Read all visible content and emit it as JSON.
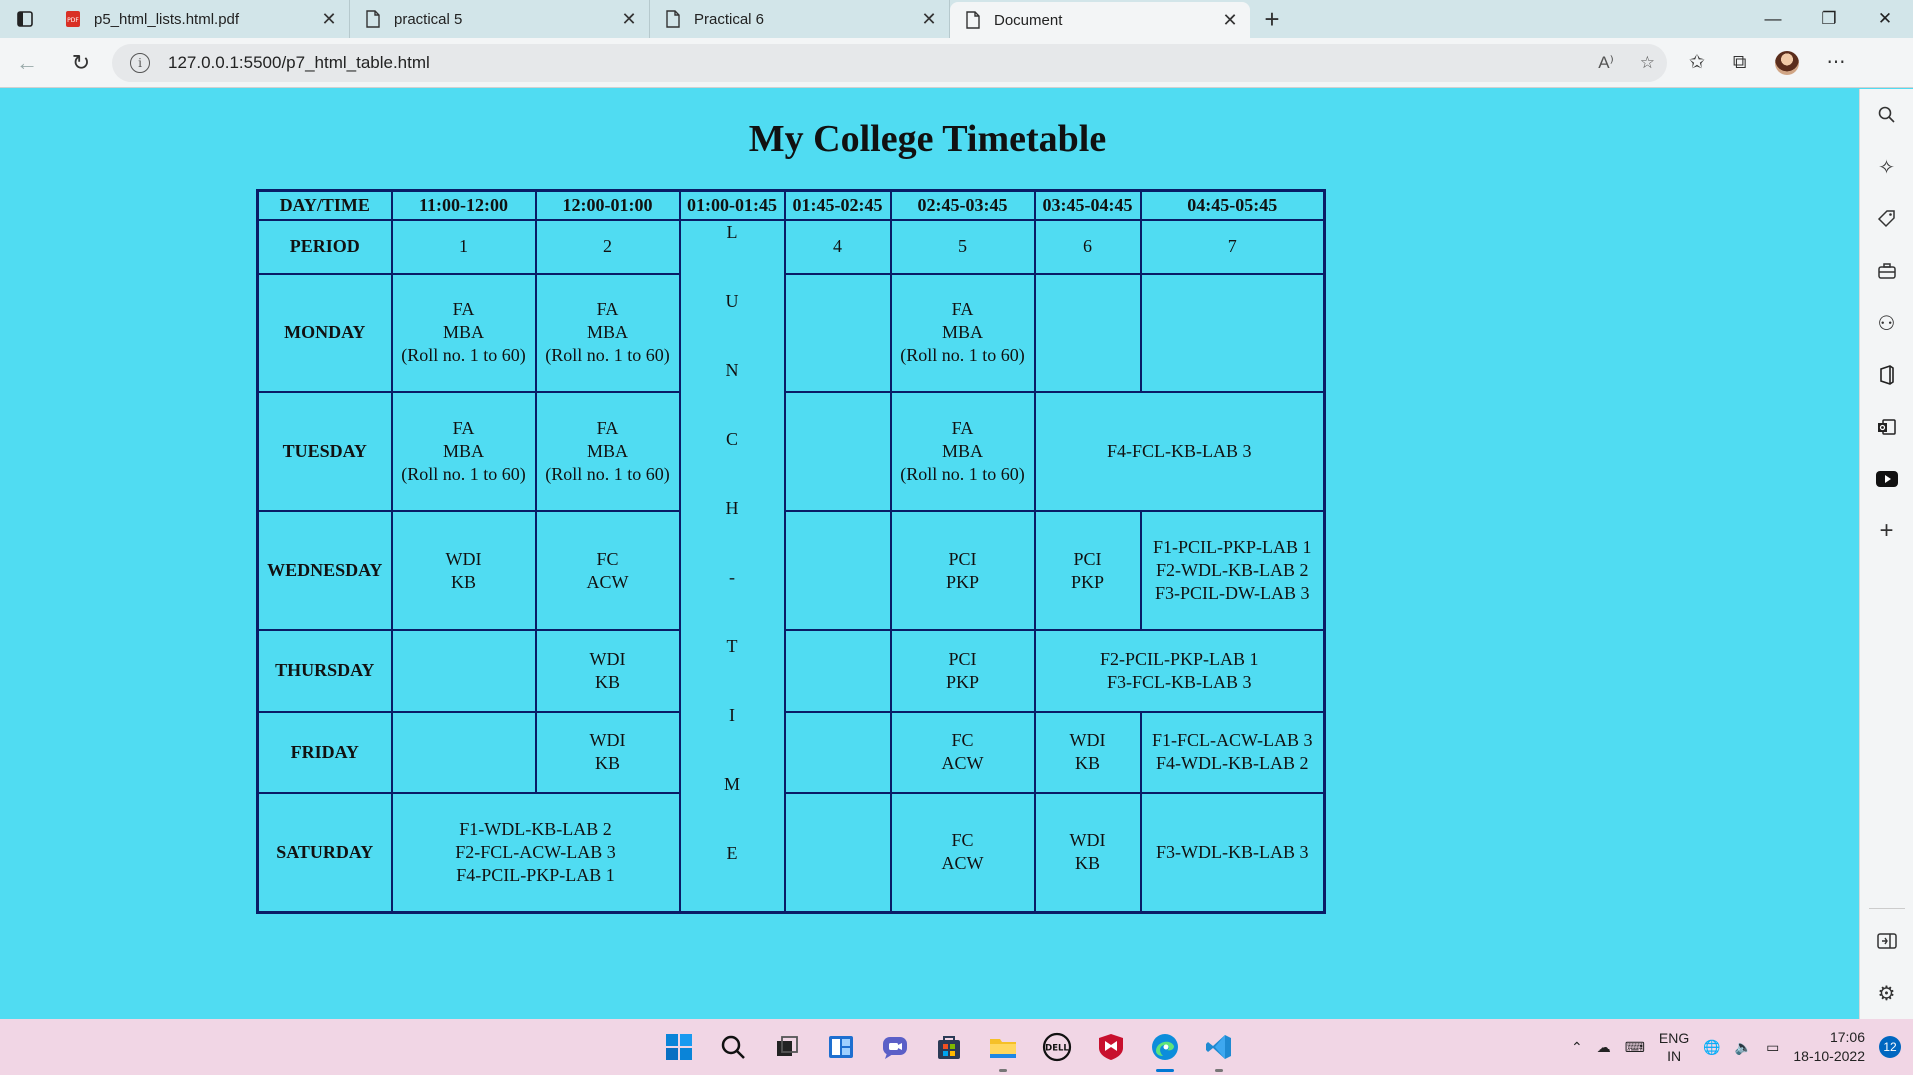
{
  "browser": {
    "tabs": [
      {
        "label": "p5_html_lists.html.pdf",
        "icon": "pdf-icon",
        "active": false
      },
      {
        "label": "practical 5",
        "icon": "page-icon",
        "active": false
      },
      {
        "label": "Practical 6",
        "icon": "page-icon",
        "active": false
      },
      {
        "label": "Document",
        "icon": "page-icon",
        "active": true
      }
    ],
    "url": "127.0.0.1:5500/p7_html_table.html"
  },
  "page": {
    "title": "My College Timetable",
    "headers": [
      "DAY/TIME",
      "11:00-12:00",
      "12:00-01:00",
      "01:00-01:45",
      "01:45-02:45",
      "02:45-03:45",
      "03:45-04:45",
      "04:45-05:45"
    ],
    "period_label": "PERIOD",
    "periods": [
      "1",
      "2",
      "4",
      "5",
      "6",
      "7"
    ],
    "lunch_letters": [
      "L",
      "U",
      "N",
      "C",
      "H",
      "-",
      "T",
      "I",
      "M",
      "E"
    ],
    "days": {
      "monday": {
        "name": "MONDAY",
        "p1": [
          "FA",
          "MBA",
          "(Roll no. 1 to 60)"
        ],
        "p2": [
          "FA",
          "MBA",
          "(Roll no. 1 to 60)"
        ],
        "p5": [
          "FA",
          "MBA",
          "(Roll no. 1 to 60)"
        ]
      },
      "tuesday": {
        "name": "TUESDAY",
        "p1": [
          "FA",
          "MBA",
          "(Roll no. 1 to 60)"
        ],
        "p2": [
          "FA",
          "MBA",
          "(Roll no. 1 to 60)"
        ],
        "p5": [
          "FA",
          "MBA",
          "(Roll no. 1 to 60)"
        ],
        "p67": "F4-FCL-KB-LAB 3"
      },
      "wednesday": {
        "name": "WEDNESDAY",
        "p1": [
          "WDI",
          "KB"
        ],
        "p2": [
          "FC",
          "ACW"
        ],
        "p5": [
          "PCI",
          "PKP"
        ],
        "p6": [
          "PCI",
          "PKP"
        ],
        "p7": [
          "F1-PCIL-PKP-LAB 1",
          "F2-WDL-KB-LAB 2",
          "F3-PCIL-DW-LAB 3"
        ]
      },
      "thursday": {
        "name": "THURSDAY",
        "p2": [
          "WDI",
          "KB"
        ],
        "p5": [
          "PCI",
          "PKP"
        ],
        "p67": [
          "F2-PCIL-PKP-LAB 1",
          "F3-FCL-KB-LAB 3"
        ]
      },
      "friday": {
        "name": "FRIDAY",
        "p2": [
          "WDI",
          "KB"
        ],
        "p5": [
          "FC",
          "ACW"
        ],
        "p6": [
          "WDI",
          "KB"
        ],
        "p7": [
          "F1-FCL-ACW-LAB 3",
          "F4-WDL-KB-LAB 2"
        ]
      },
      "saturday": {
        "name": "SATURDAY",
        "p12": [
          "F1-WDL-KB-LAB 2",
          "F2-FCL-ACW-LAB 3",
          "F4-PCIL-PKP-LAB 1"
        ],
        "p5": [
          "FC",
          "ACW"
        ],
        "p6": [
          "WDI",
          "KB"
        ],
        "p7": "F3-WDL-KB-LAB 3"
      }
    }
  },
  "taskbar": {
    "lang": [
      "ENG",
      "IN"
    ],
    "time": "17:06",
    "date": "18-10-2022",
    "notifications": "12"
  }
}
